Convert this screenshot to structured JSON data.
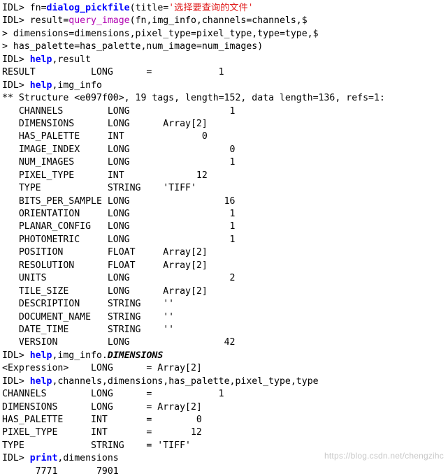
{
  "console": {
    "watermark": "https://blog.csdn.net/chengzihc",
    "lines": [
      {
        "id": "l1",
        "segments": [
          {
            "t": "IDL> ",
            "c": "plain"
          },
          {
            "t": "fn=",
            "c": "plain"
          },
          {
            "t": "dialog_pickfile",
            "c": "kw-blue"
          },
          {
            "t": "(title=",
            "c": "plain"
          },
          {
            "t": "'选择要查询的文件'",
            "c": "kw-red"
          }
        ]
      },
      {
        "id": "l2",
        "segments": [
          {
            "t": "IDL> ",
            "c": "plain"
          },
          {
            "t": "result=",
            "c": "plain"
          },
          {
            "t": "query_image",
            "c": "kw-magenta"
          },
          {
            "t": "(fn,img_info,channels=channels,$",
            "c": "plain"
          }
        ]
      },
      {
        "id": "l3",
        "segments": [
          {
            "t": "> dimensions=dimensions,pixel_type=pixel_type,type=type,$",
            "c": "plain"
          }
        ]
      },
      {
        "id": "l4",
        "segments": [
          {
            "t": "> has_palette=has_palette,num_image=num_images)",
            "c": "plain"
          }
        ]
      },
      {
        "id": "l5",
        "segments": [
          {
            "t": "IDL> ",
            "c": "plain"
          },
          {
            "t": "help",
            "c": "kw-blue"
          },
          {
            "t": ",result",
            "c": "plain"
          }
        ]
      },
      {
        "id": "l6",
        "segments": [
          {
            "t": "RESULT          LONG      =            1",
            "c": "plain"
          }
        ]
      },
      {
        "id": "l7",
        "segments": [
          {
            "t": "IDL> ",
            "c": "plain"
          },
          {
            "t": "help",
            "c": "kw-blue"
          },
          {
            "t": ",img_info",
            "c": "plain"
          }
        ]
      },
      {
        "id": "l8",
        "segments": [
          {
            "t": "** Structure <e097f00>, 19 tags, length=152, data length=136, refs=1:",
            "c": "plain"
          }
        ]
      },
      {
        "id": "l9",
        "segments": [
          {
            "t": "   CHANNELS        LONG                  1",
            "c": "plain"
          }
        ]
      },
      {
        "id": "l10",
        "segments": [
          {
            "t": "   DIMENSIONS      LONG      Array[2]",
            "c": "plain"
          }
        ]
      },
      {
        "id": "l11",
        "segments": [
          {
            "t": "   HAS_PALETTE     INT              0",
            "c": "plain"
          }
        ]
      },
      {
        "id": "l12",
        "segments": [
          {
            "t": "   IMAGE_INDEX     LONG                  0",
            "c": "plain"
          }
        ]
      },
      {
        "id": "l13",
        "segments": [
          {
            "t": "   NUM_IMAGES      LONG                  1",
            "c": "plain"
          }
        ]
      },
      {
        "id": "l14",
        "segments": [
          {
            "t": "   PIXEL_TYPE      INT             12",
            "c": "plain"
          }
        ]
      },
      {
        "id": "l15",
        "segments": [
          {
            "t": "   TYPE            STRING    'TIFF'",
            "c": "plain"
          }
        ]
      },
      {
        "id": "l16",
        "segments": [
          {
            "t": "   BITS_PER_SAMPLE LONG                 16",
            "c": "plain"
          }
        ]
      },
      {
        "id": "l17",
        "segments": [
          {
            "t": "   ORIENTATION     LONG                  1",
            "c": "plain"
          }
        ]
      },
      {
        "id": "l18",
        "segments": [
          {
            "t": "   PLANAR_CONFIG   LONG                  1",
            "c": "plain"
          }
        ]
      },
      {
        "id": "l19",
        "segments": [
          {
            "t": "   PHOTOMETRIC     LONG                  1",
            "c": "plain"
          }
        ]
      },
      {
        "id": "l20",
        "segments": [
          {
            "t": "   POSITION        FLOAT     Array[2]",
            "c": "plain"
          }
        ]
      },
      {
        "id": "l21",
        "segments": [
          {
            "t": "   RESOLUTION      FLOAT     Array[2]",
            "c": "plain"
          }
        ]
      },
      {
        "id": "l22",
        "segments": [
          {
            "t": "   UNITS           LONG                  2",
            "c": "plain"
          }
        ]
      },
      {
        "id": "l23",
        "segments": [
          {
            "t": "   TILE_SIZE       LONG      Array[2]",
            "c": "plain"
          }
        ]
      },
      {
        "id": "l24",
        "segments": [
          {
            "t": "   DESCRIPTION     STRING    ''",
            "c": "plain"
          }
        ]
      },
      {
        "id": "l25",
        "segments": [
          {
            "t": "   DOCUMENT_NAME   STRING    ''",
            "c": "plain"
          }
        ]
      },
      {
        "id": "l26",
        "segments": [
          {
            "t": "   DATE_TIME       STRING    ''",
            "c": "plain"
          }
        ]
      },
      {
        "id": "l27",
        "segments": [
          {
            "t": "   VERSION         LONG                 42",
            "c": "plain"
          }
        ]
      },
      {
        "id": "l28",
        "segments": [
          {
            "t": "IDL> ",
            "c": "plain"
          },
          {
            "t": "help",
            "c": "kw-blue"
          },
          {
            "t": ",img_info.",
            "c": "plain"
          },
          {
            "t": "DIMENSIONS",
            "c": "italic"
          }
        ]
      },
      {
        "id": "l29",
        "segments": [
          {
            "t": "<Expression>    LONG      = Array[2]",
            "c": "plain"
          }
        ]
      },
      {
        "id": "l30",
        "segments": [
          {
            "t": "IDL> ",
            "c": "plain"
          },
          {
            "t": "help",
            "c": "kw-blue"
          },
          {
            "t": ",channels,dimensions,has_palette,pixel_type,type",
            "c": "plain"
          }
        ]
      },
      {
        "id": "l31",
        "segments": [
          {
            "t": "CHANNELS        LONG      =            1",
            "c": "plain"
          }
        ]
      },
      {
        "id": "l32",
        "segments": [
          {
            "t": "DIMENSIONS      LONG      = Array[2]",
            "c": "plain"
          }
        ]
      },
      {
        "id": "l33",
        "segments": [
          {
            "t": "HAS_PALETTE     INT       =        0",
            "c": "plain"
          }
        ]
      },
      {
        "id": "l34",
        "segments": [
          {
            "t": "PIXEL_TYPE      INT       =       12",
            "c": "plain"
          }
        ]
      },
      {
        "id": "l35",
        "segments": [
          {
            "t": "TYPE            STRING    = 'TIFF'",
            "c": "plain"
          }
        ]
      },
      {
        "id": "l36",
        "segments": [
          {
            "t": "IDL> ",
            "c": "plain"
          },
          {
            "t": "print",
            "c": "kw-blue"
          },
          {
            "t": ",dimensions",
            "c": "plain"
          }
        ]
      },
      {
        "id": "l37",
        "segments": [
          {
            "t": "      7771       7901",
            "c": "plain"
          }
        ]
      }
    ]
  }
}
